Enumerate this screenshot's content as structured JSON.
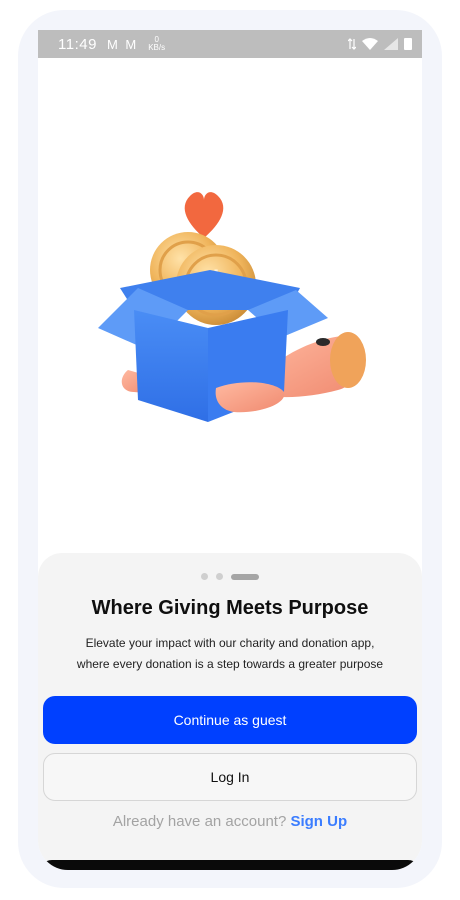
{
  "status_bar": {
    "time": "11:49",
    "mail_icons": "M M",
    "speed_value": "0",
    "speed_unit": "KB/s"
  },
  "onboarding": {
    "title": "Where Giving Meets Purpose",
    "subtitle_line1": "Elevate your impact with our charity and donation app,",
    "subtitle_line2": "where every donation is a step towards a greater purpose",
    "pager": {
      "total": 3,
      "active": 3
    }
  },
  "actions": {
    "continue_label": "Continue as guest",
    "login_label": "Log In",
    "signup_prompt": "Already have an account?",
    "signup_link": "Sign Up"
  },
  "colors": {
    "primary": "#0040ff",
    "link": "#3b7dff",
    "sheet_bg": "#f4f4f4"
  },
  "icons": [
    "wifi-icon",
    "signal-icon",
    "battery-icon",
    "donation-box-illustration"
  ]
}
